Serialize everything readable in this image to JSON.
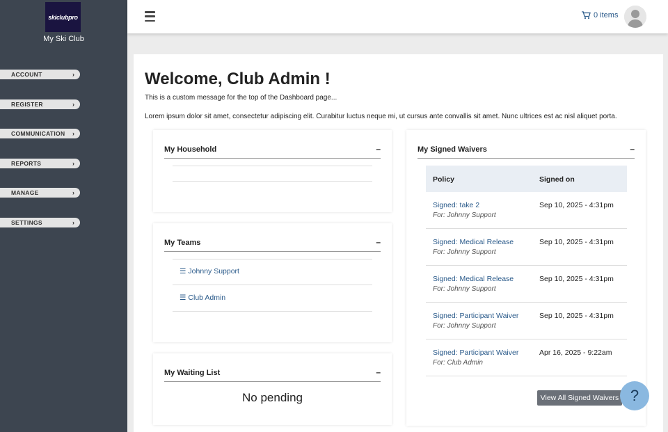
{
  "sidebar": {
    "logo_text": "skiclubpro",
    "club_name": "My Ski Club",
    "items": [
      {
        "label": "ACCOUNT"
      },
      {
        "label": "REGISTER"
      },
      {
        "label": "COMMUNICATION"
      },
      {
        "label": "REPORTS"
      },
      {
        "label": "MANAGE"
      },
      {
        "label": "SETTINGS"
      }
    ]
  },
  "topbar": {
    "cart_label": "0 items"
  },
  "main": {
    "welcome": "Welcome, Club Admin !",
    "custom_message": "This is a custom message for the top of the Dashboard page...",
    "lorem": "Lorem ipsum dolor sit amet, consectetur adipiscing elit. Curabitur luctus neque mi, ut cursus ante convallis sit amet. Nunc ultrices est ac nisl aliquet porta."
  },
  "household": {
    "title": "My Household",
    "collapse": "–"
  },
  "teams": {
    "title": "My Teams",
    "collapse": "–",
    "items": [
      "Johnny Support",
      "Club Admin"
    ]
  },
  "waiting": {
    "title": "My Waiting List",
    "collapse": "–",
    "empty": "No pending"
  },
  "waivers": {
    "title": "My Signed Waivers",
    "collapse": "–",
    "col_policy": "Policy",
    "col_signed": "Signed on",
    "rows": [
      {
        "policy": "Signed: take 2",
        "for": "For: Johnny Support",
        "date": "Sep 10, 2025 - 4:31pm"
      },
      {
        "policy": "Signed: Medical Release",
        "for": "For: Johnny Support",
        "date": "Sep 10, 2025 - 4:31pm"
      },
      {
        "policy": "Signed: Medical Release",
        "for": "For: Johnny Support",
        "date": "Sep 10, 2025 - 4:31pm"
      },
      {
        "policy": "Signed: Participant Waiver",
        "for": "For: Johnny Support",
        "date": "Sep 10, 2025 - 4:31pm"
      },
      {
        "policy": "Signed: Participant Waiver",
        "for": "For: Club Admin",
        "date": "Apr 16, 2025 - 9:22am"
      }
    ],
    "view_all": "View All Signed Waivers"
  },
  "help_label": "?"
}
